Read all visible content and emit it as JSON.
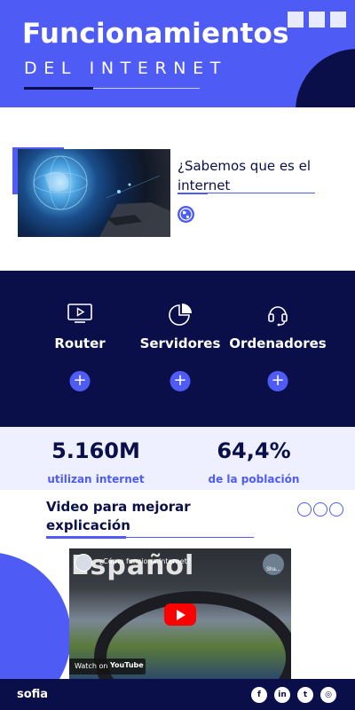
{
  "header": {
    "title": "Funcionamientos",
    "subtitle": "DEL INTERNET",
    "colors": {
      "primary": "#4f5bf5",
      "navy": "#0a0f4a"
    }
  },
  "intro": {
    "question": "¿Sabemos que es el internet",
    "icon": "globe-icon"
  },
  "features": [
    {
      "label": "Router",
      "icon": "monitor-play-icon",
      "action": "+"
    },
    {
      "label": "Servidores",
      "icon": "pie-chart-icon",
      "action": "+"
    },
    {
      "label": "Ordenadores",
      "icon": "headset-icon",
      "action": "+"
    }
  ],
  "stats": [
    {
      "value": "5.160M",
      "caption": "utilizan internet"
    },
    {
      "value": "64,4%",
      "caption": "de la población"
    }
  ],
  "video_section": {
    "title": "Video para mejorar explicación",
    "video": {
      "overlay_text": "Español",
      "title": "¿Cómo funciona Internet?",
      "share_label": "Sha...",
      "watch_label": "Watch on",
      "platform": "YouTube"
    }
  },
  "footer": {
    "author": "sofia",
    "social": [
      {
        "name": "facebook",
        "glyph": "f"
      },
      {
        "name": "linkedin",
        "glyph": "in"
      },
      {
        "name": "twitter",
        "glyph": "t"
      },
      {
        "name": "instagram",
        "glyph": "◎"
      }
    ]
  }
}
